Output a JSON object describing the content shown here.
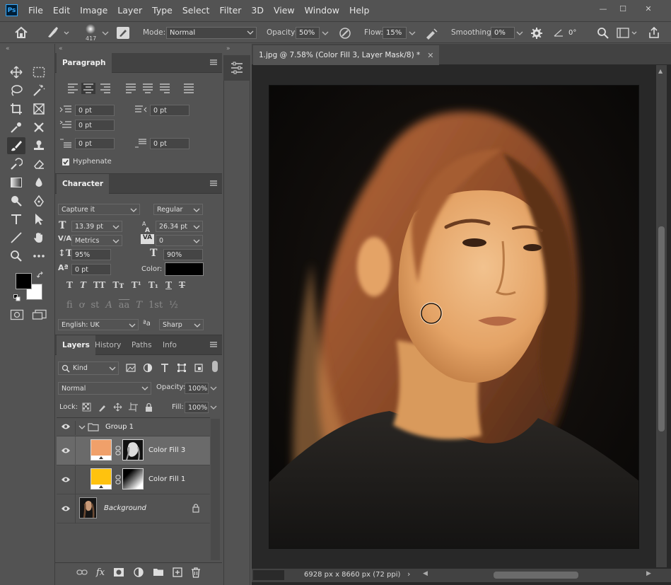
{
  "app": {
    "logo": "Ps"
  },
  "menu": [
    "File",
    "Edit",
    "Image",
    "Layer",
    "Type",
    "Select",
    "Filter",
    "3D",
    "View",
    "Window",
    "Help"
  ],
  "window_controls": {
    "minimize": "—",
    "restore": "☐",
    "close": "✕"
  },
  "options_bar": {
    "brush_size": "417",
    "mode_label": "Mode:",
    "mode_value": "Normal",
    "opacity_label": "Opacity:",
    "opacity_value": "50%",
    "flow_label": "Flow:",
    "flow_value": "15%",
    "smoothing_label": "Smoothing:",
    "smoothing_value": "0%",
    "angle_value": "0°"
  },
  "paragraph_panel": {
    "tab": "Paragraph",
    "indent_left": "0 pt",
    "indent_right": "0 pt",
    "indent_first": "0 pt",
    "space_before": "0 pt",
    "space_after": "0 pt",
    "hyphenate_label": "Hyphenate",
    "hyphenate_checked": true
  },
  "character_panel": {
    "tab": "Character",
    "font_family": "Capture it",
    "font_style": "Regular",
    "font_size": "13.39 pt",
    "leading": "26.34 pt",
    "kerning": "Metrics",
    "tracking": "0",
    "vertical_scale": "95%",
    "horizontal_scale": "90%",
    "baseline_shift": "0 pt",
    "color_label": "Color:",
    "color_value": "#000000",
    "language": "English: UK",
    "aa_label": "ªa",
    "antialias": "Sharp",
    "style_buttons": [
      "T",
      "T",
      "TT",
      "Tт",
      "T¹",
      "T₁",
      "T",
      "T"
    ],
    "opentype_buttons": [
      "fi",
      "ơ",
      "st",
      "A",
      "aa",
      "T",
      "1st",
      "½"
    ]
  },
  "layers_panel": {
    "tabs": [
      "Layers",
      "History",
      "Paths",
      "Info"
    ],
    "filter_kind": "Kind",
    "blend_mode": "Normal",
    "opacity_label": "Opacity:",
    "opacity_value": "100%",
    "lock_label": "Lock:",
    "fill_label": "Fill:",
    "fill_value": "100%",
    "layers": [
      {
        "name": "Group 1"
      },
      {
        "name": "Color Fill 3",
        "color": "#f0a06a"
      },
      {
        "name": "Color Fill 1",
        "color": "#ffc20e"
      },
      {
        "name": "Background"
      }
    ],
    "footer_fx": "fx"
  },
  "document": {
    "tab_title": "1.jpg @ 7.58% (Color Fill 3, Layer Mask/8) *",
    "status": "6928 px x 8660 px (72 ppi)"
  },
  "colors": {
    "foreground": "#000000",
    "background": "#ffffff",
    "ui_dark": "#535353",
    "accent_ps": "#31a8ff"
  }
}
